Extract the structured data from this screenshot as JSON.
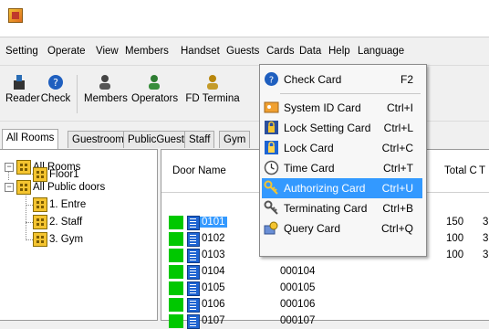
{
  "menubar": {
    "items": [
      {
        "label": "Setting",
        "key": "S"
      },
      {
        "label": "Operate",
        "key": "O"
      },
      {
        "label": "View",
        "key": "V"
      },
      {
        "label": "Members",
        "key": "M"
      },
      {
        "label": "Handset",
        "key": "a"
      },
      {
        "label": "Guests",
        "key": "G"
      },
      {
        "label": "Cards",
        "key": "C"
      },
      {
        "label": "Data",
        "key": "D"
      },
      {
        "label": "Help",
        "key": "H"
      },
      {
        "label": "Language",
        "key": "L"
      }
    ]
  },
  "toolbar": {
    "reader": "Reader",
    "check": "Check",
    "members": "Members",
    "operators": "Operators",
    "fd_terminal": "FD Termina"
  },
  "tabs": [
    "All Rooms",
    "Guestroom",
    "PublicGuest",
    "Staff",
    "Gym"
  ],
  "tree": {
    "all_rooms": "All Rooms",
    "floor1": "Floor1",
    "all_public": "All Public doors",
    "entre": "1. Entre",
    "staff": "2. Staff",
    "gym": "3. Gym"
  },
  "grid": {
    "headers": {
      "door_name": "Door Name",
      "total": "Total C...",
      "extra": "T"
    },
    "rows": [
      {
        "name": "0101",
        "code": "",
        "total": "150",
        "extra": "3",
        "selected": true
      },
      {
        "name": "0102",
        "code": "",
        "total": "100",
        "extra": "3",
        "selected": false
      },
      {
        "name": "0103",
        "code": "",
        "total": "100",
        "extra": "3",
        "selected": false
      },
      {
        "name": "0104",
        "code": "000104",
        "total": "",
        "extra": "",
        "selected": false
      },
      {
        "name": "0105",
        "code": "000105",
        "total": "",
        "extra": "",
        "selected": false
      },
      {
        "name": "0106",
        "code": "000106",
        "total": "",
        "extra": "",
        "selected": false
      },
      {
        "name": "0107",
        "code": "000107",
        "total": "",
        "extra": "",
        "selected": false
      }
    ]
  },
  "cards_menu": [
    {
      "label": "Check Card",
      "shortcut": "F2",
      "icon": "help-circle-icon"
    },
    {
      "label": "System ID Card",
      "shortcut": "Ctrl+I",
      "icon": "id-card-icon"
    },
    {
      "label": "Lock Setting Card",
      "shortcut": "Ctrl+L",
      "icon": "lock-setting-icon"
    },
    {
      "label": "Lock Card",
      "shortcut": "Ctrl+C",
      "icon": "lock-card-icon"
    },
    {
      "label": "Time Card",
      "shortcut": "Ctrl+T",
      "icon": "clock-icon"
    },
    {
      "label": "Authorizing Card",
      "shortcut": "Ctrl+U",
      "icon": "key-icon",
      "highlighted": true
    },
    {
      "label": "Terminating Card",
      "shortcut": "Ctrl+B",
      "icon": "terminate-key-icon"
    },
    {
      "label": "Query Card",
      "shortcut": "Ctrl+Q",
      "icon": "query-card-icon"
    }
  ],
  "colors": {
    "status_green": "#00c800",
    "highlight": "#3399ff",
    "door_icon": "#1e64d2"
  }
}
